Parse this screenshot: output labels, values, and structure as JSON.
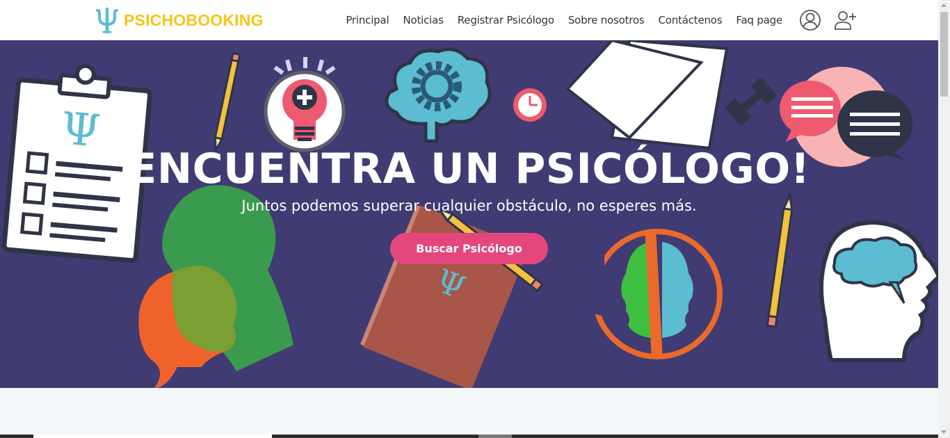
{
  "brand": {
    "name": "PSICHOBOOKING",
    "logo_icon": "psi-icon",
    "color": "#f5c518",
    "logo_color": "#5bbcd2"
  },
  "nav": {
    "links": [
      "Principal",
      "Noticias",
      "Registrar Psicólogo",
      "Sobre nosotros",
      "Contáctenos",
      "Faq page"
    ],
    "icons": [
      "user-account-icon",
      "add-user-icon"
    ]
  },
  "hero": {
    "title": "ENCUENTRA UN PSICÓLOGO!",
    "subtitle": "Juntos podemos superar cualquier obstáculo, no esperes más.",
    "button_label": "Buscar Psicólogo",
    "background_color": "#413b74",
    "button_color": "#e4467e",
    "illustrations": [
      "clipboard-checklist",
      "pencil",
      "lightbulb-with-plus",
      "brain-with-gear",
      "clock",
      "papers",
      "dumbbell",
      "speech-bubbles",
      "overlapping-heads",
      "notebook-with-psi",
      "pencil",
      "two-faces-circle",
      "pencil",
      "head-with-cloud"
    ]
  }
}
